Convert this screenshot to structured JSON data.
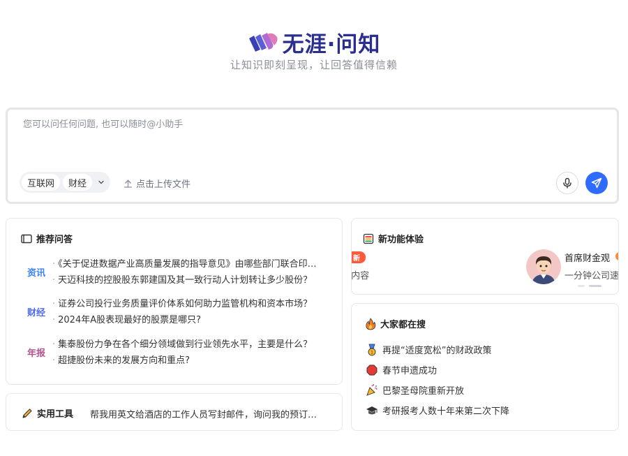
{
  "brand": {
    "title": "无涯·问知",
    "slogan": "让知识即刻呈现，让回答值得信赖"
  },
  "search": {
    "placeholder": "您可以问任何问题, 也可以随时@小助手",
    "sources": [
      "互联网",
      "财经"
    ],
    "upload_label": "点击上传文件"
  },
  "recommended": {
    "title": "推荐问答",
    "groups": [
      {
        "tag": "资讯",
        "color": "#3b82f6",
        "items": [
          "《关于促进数据产业高质量发展的指导意见》由哪些部门联合印发？",
          "天迈科技的控股股东郭建国及其一致行动人计划转让多少股份？"
        ]
      },
      {
        "tag": "财经",
        "color": "#4f6bed",
        "items": [
          "证券公司投行业务质量评价体系如何助力监管机构和资本市场？",
          "2024年A股表现最好的股票是哪只?"
        ]
      },
      {
        "tag": "年报",
        "color": "#b4568e",
        "items": [
          "集泰股份力争在各个细分领域做到行业领先水平，主要是什么？",
          "超捷股份未来的发展方向和重点?"
        ]
      }
    ]
  },
  "tools": {
    "title": "实用工具",
    "text": "帮我用英文给酒店的工作人员写封邮件，询问我的预订信息是否已确认"
  },
  "features": {
    "title": "新功能体验",
    "badge": "新",
    "left_desc": "t内容",
    "name": "首席财金观",
    "desc": "一分钟公司速"
  },
  "hot": {
    "title": "大家都在搜",
    "items": [
      {
        "icon": "medal-icon",
        "text": "再提“适度宽松”的财政政策"
      },
      {
        "icon": "hexagon-icon",
        "text": "春节申遗成功"
      },
      {
        "icon": "party-popper-icon",
        "text": "巴黎圣母院重新开放"
      },
      {
        "icon": "graduation-cap-icon",
        "text": "考研报考人数十年来第二次下降"
      }
    ]
  }
}
